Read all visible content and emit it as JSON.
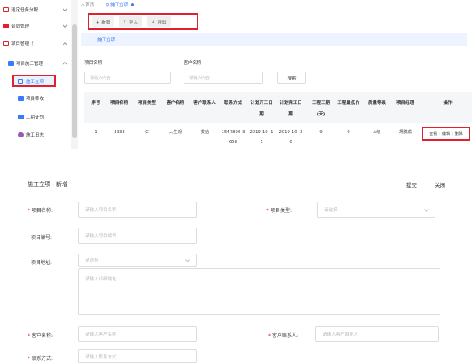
{
  "sidebar": {
    "items": [
      {
        "label": "退定任务分配"
      },
      {
        "label": "合同管理"
      },
      {
        "label": "项目管理（..."
      },
      {
        "label": "项目施工管理"
      },
      {
        "label": "施工立项"
      },
      {
        "label": "项目移收"
      },
      {
        "label": "工期计划"
      },
      {
        "label": "施工日志"
      }
    ]
  },
  "breadcrumb": {
    "home": "首页",
    "current": "施工立项"
  },
  "toolbar": {
    "add": "+ 新增",
    "import": "导入",
    "export": "导出"
  },
  "tabs": {
    "active": "施工立项"
  },
  "filters": {
    "project_name_label": "项目名称",
    "project_name_placeholder": "请输入内容",
    "customer_name_label": "客户名称",
    "customer_name_placeholder": "请输入内容",
    "search_label": "搜索"
  },
  "table": {
    "headers": [
      "序号",
      "项目名称",
      "项目类型",
      "客户名称",
      "客户联系人",
      "联系方式",
      "计划开工日期",
      "计划完工日期",
      "工程工期(天)",
      "工程最低价",
      "质量等级",
      "项目经理",
      "操作"
    ],
    "rows": [
      {
        "no": "1",
        "project_name": "3333",
        "project_type": "C",
        "customer": "人生观",
        "contact": "发给",
        "phone": "1547896 3658",
        "plan_start": "2019-10- 11",
        "plan_end": "2019-10- 20",
        "duration": "9",
        "min_price": "9",
        "quality": "A级",
        "manager": "胡鹏成",
        "op_view": "查看",
        "op_edit": "编辑",
        "op_delete": "删除"
      }
    ]
  },
  "form": {
    "title": "施工立项 - 新增",
    "submit": "提交",
    "close": "关闭",
    "project_name_label": "项目名称:",
    "project_name_placeholder": "请输入项目名称",
    "project_type_label": "项目类型:",
    "project_type_placeholder": "请选择",
    "project_code_label": "项目编号:",
    "project_code_placeholder": "请输入项目编号",
    "project_address_label": "项目地址:",
    "project_address_placeholder": "请选择",
    "address_detail_placeholder": "请输入详细地址",
    "customer_name_label": "客户名称:",
    "customer_name_placeholder": "请输入客户名称",
    "customer_contact_label": "客户联系人:",
    "customer_contact_placeholder": "请输入客户联系人",
    "contact_phone_label": "联系方式:",
    "contact_phone_placeholder": "请输入联系方式"
  },
  "colors": {
    "accent": "#3a7afe",
    "highlight": "#e0202c"
  }
}
